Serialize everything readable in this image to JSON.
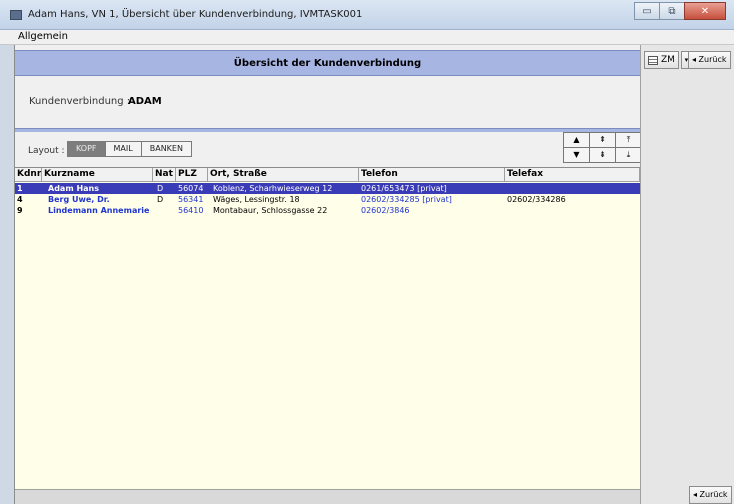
{
  "window": {
    "title": "Adam Hans, VN 1, Übersicht über Kundenverbindung, IVMTASK001",
    "min_glyph": "▭",
    "max_glyph": "⧉",
    "close_glyph": "✕"
  },
  "menu": {
    "items": [
      "Allgemein"
    ]
  },
  "header": {
    "title": "Übersicht der Kundenverbindung"
  },
  "kundenverbindung": {
    "label": "Kundenverbindung :",
    "value": "ADAM"
  },
  "layout": {
    "label": "Layout :",
    "options": [
      "KOPF",
      "MAIL",
      "BANKEN"
    ],
    "selected": "KOPF"
  },
  "scroll": {
    "up": "▲",
    "page_up": "⇞",
    "top": "⤒",
    "down": "▼",
    "page_down": "⇟",
    "bottom": "⤓"
  },
  "table": {
    "columns": [
      "Kdnr.",
      "Kurzname",
      "Nat",
      "PLZ",
      "Ort, Straße",
      "Telefon",
      "Telefax"
    ],
    "rows": [
      {
        "kdnr": "1",
        "kurzname": "Adam Hans",
        "nat": "D",
        "plz": "56074",
        "ort": "Koblenz, Scharhwieserweg 12",
        "telefon": "0261/653473 [privat]",
        "telefax": "",
        "selected": true
      },
      {
        "kdnr": "4",
        "kurzname": "Berg Uwe, Dr.",
        "nat": "D",
        "plz": "56341",
        "ort": "Wäges, Lessingstr. 18",
        "telefon": "02602/334285 [privat]",
        "telefax": "02602/334286",
        "selected": false
      },
      {
        "kdnr": "9",
        "kurzname": "Lindemann Annemarie",
        "nat": "",
        "plz": "56410",
        "ort": "Montabaur, Schlossgasse 22",
        "telefon": "02602/3846",
        "telefax": "",
        "selected": false
      }
    ]
  },
  "right_panel": {
    "zm_label": "ZM",
    "zm_icon": "list-icon",
    "dropdown_glyph": "▾",
    "back_label": "◂ Zurück",
    "bottom_back_label": "◂ Zurück"
  },
  "colors": {
    "header_band": "#a7b5e2",
    "selected_row": "#3a3bb6",
    "table_bg": "#fffee8",
    "link_blue": "#2035d0"
  }
}
